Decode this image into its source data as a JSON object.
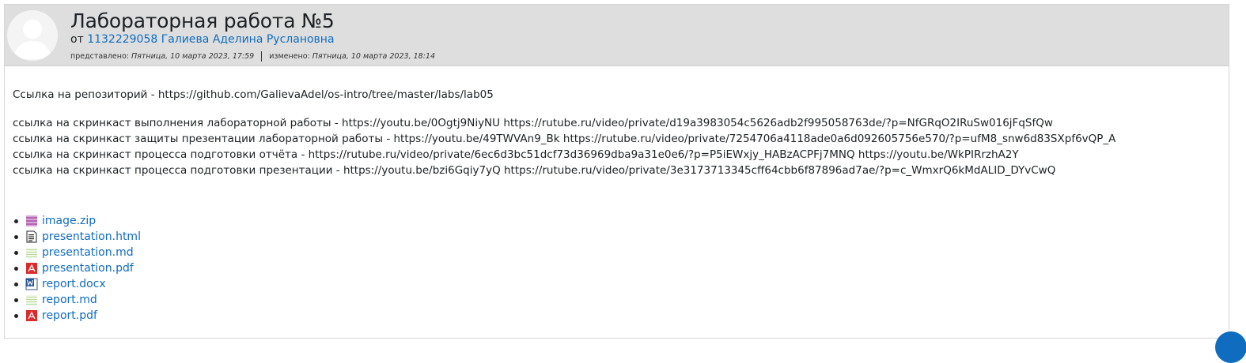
{
  "post": {
    "subject": "Лабораторная работа №5",
    "author_prefix": "от",
    "author_name": "1132229058 Галиева Аделина Руслановна",
    "submitted_label": "представлено:",
    "submitted_date": "Пятница, 10 марта 2023, 17:59",
    "modified_label": "изменено:",
    "modified_date": "Пятница, 10 марта 2023, 18:14"
  },
  "body": {
    "repo_line": "Ссылка на репозиторий - https://github.com/GalievaAdel/os-intro/tree/master/labs/lab05",
    "lines": [
      "ссылка на скринкаст выполнения лабораторной работы - https://youtu.be/0Ogtj9NiyNU  https://rutube.ru/video/private/d19a3983054c5626adb2f995058763de/?p=NfGRqO2IRuSw016jFqSfQw",
      "ссылка на скринкаст защиты презентации лабораторной работы -  https://youtu.be/49TWVAn9_Bk  https://rutube.ru/video/private/7254706a4118ade0a6d092605756e570/?p=ufM8_snw6d83SXpf6vQP_A",
      "ссылка на скринкаст процесса подготовки отчёта - https://rutube.ru/video/private/6ec6d3bc51dcf73d36969dba9a31e0e6/?p=P5iEWxjy_HABzACPFj7MNQ  https://youtu.be/WkPIRrzhA2Y",
      "ссылка на скринкаст процесса подготовки презентации - https://youtu.be/bzi6Gqiy7yQ  https://rutube.ru/video/private/3e3173713345cff64cbb6f87896ad7ae/?p=c_WmxrQ6kMdALID_DYvCwQ"
    ]
  },
  "attachments": [
    {
      "name": "image.zip",
      "icon": "archive-icon"
    },
    {
      "name": "presentation.html",
      "icon": "html-file-icon"
    },
    {
      "name": "presentation.md",
      "icon": "text-file-icon"
    },
    {
      "name": "presentation.pdf",
      "icon": "pdf-icon"
    },
    {
      "name": "report.docx",
      "icon": "word-document-icon"
    },
    {
      "name": "report.md",
      "icon": "text-file-icon"
    },
    {
      "name": "report.pdf",
      "icon": "pdf-icon"
    }
  ],
  "colors": {
    "link": "#0f6cbf",
    "header_bg": "#dedede",
    "pdf": "#d92b2b",
    "archive": "#b565b5",
    "word": "#2b5797"
  }
}
